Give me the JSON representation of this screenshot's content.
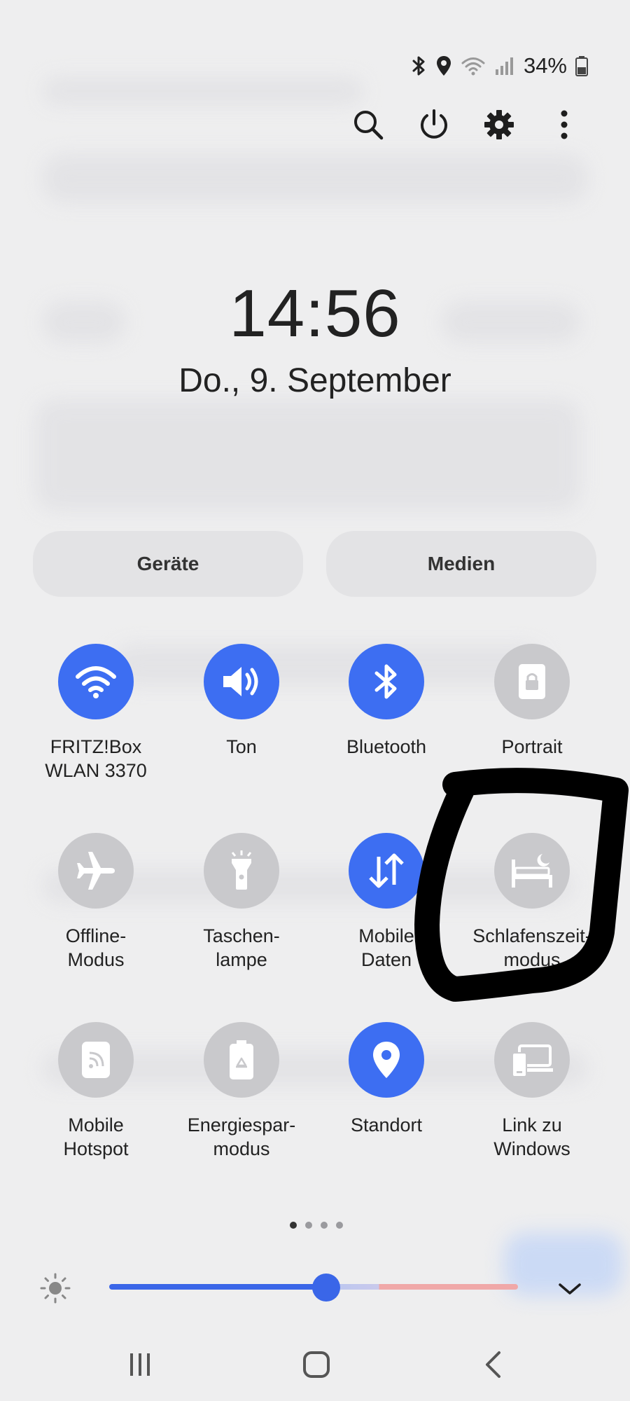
{
  "status_bar": {
    "battery_percent": "34%",
    "icons": [
      "bluetooth-icon",
      "location-icon",
      "wifi-icon",
      "signal-icon",
      "battery-icon"
    ]
  },
  "top_actions": [
    "search-icon",
    "power-icon",
    "settings-icon",
    "more-options-icon"
  ],
  "clock": {
    "time": "14:56",
    "date": "Do., 9. September"
  },
  "pills": {
    "devices_label": "Geräte",
    "media_label": "Medien"
  },
  "tiles": [
    {
      "label": "FRITZ!Box\nWLAN 3370",
      "icon": "wifi-icon",
      "active": true
    },
    {
      "label": "Ton",
      "icon": "sound-icon",
      "active": true
    },
    {
      "label": "Bluetooth",
      "icon": "bluetooth-icon",
      "active": true
    },
    {
      "label": "Portrait",
      "icon": "portrait-lock-icon",
      "active": false
    },
    {
      "label": "Offline-\nModus",
      "icon": "airplane-icon",
      "active": false
    },
    {
      "label": "Taschen-\nlampe",
      "icon": "flashlight-icon",
      "active": false
    },
    {
      "label": "Mobile\nDaten",
      "icon": "mobile-data-icon",
      "active": true
    },
    {
      "label": "Schlafenszeit-\nmodus",
      "icon": "bedtime-icon",
      "active": false
    },
    {
      "label": "Mobile\nHotspot",
      "icon": "hotspot-icon",
      "active": false
    },
    {
      "label": "Energiespar-\nmodus",
      "icon": "power-saving-icon",
      "active": false
    },
    {
      "label": "Standort",
      "icon": "location-icon",
      "active": true
    },
    {
      "label": "Link zu\nWindows",
      "icon": "link-to-windows-icon",
      "active": false
    }
  ],
  "pagination": {
    "pages": 4,
    "current": 1
  },
  "brightness": {
    "level": 0.53,
    "icon": "brightness-icon"
  },
  "nav_bar": [
    "recent-apps-icon",
    "home-icon",
    "back-icon"
  ],
  "colors": {
    "accent": "#3d6ef2",
    "tile_inactive": "#c9c9cc",
    "background": "#eeeeef"
  }
}
